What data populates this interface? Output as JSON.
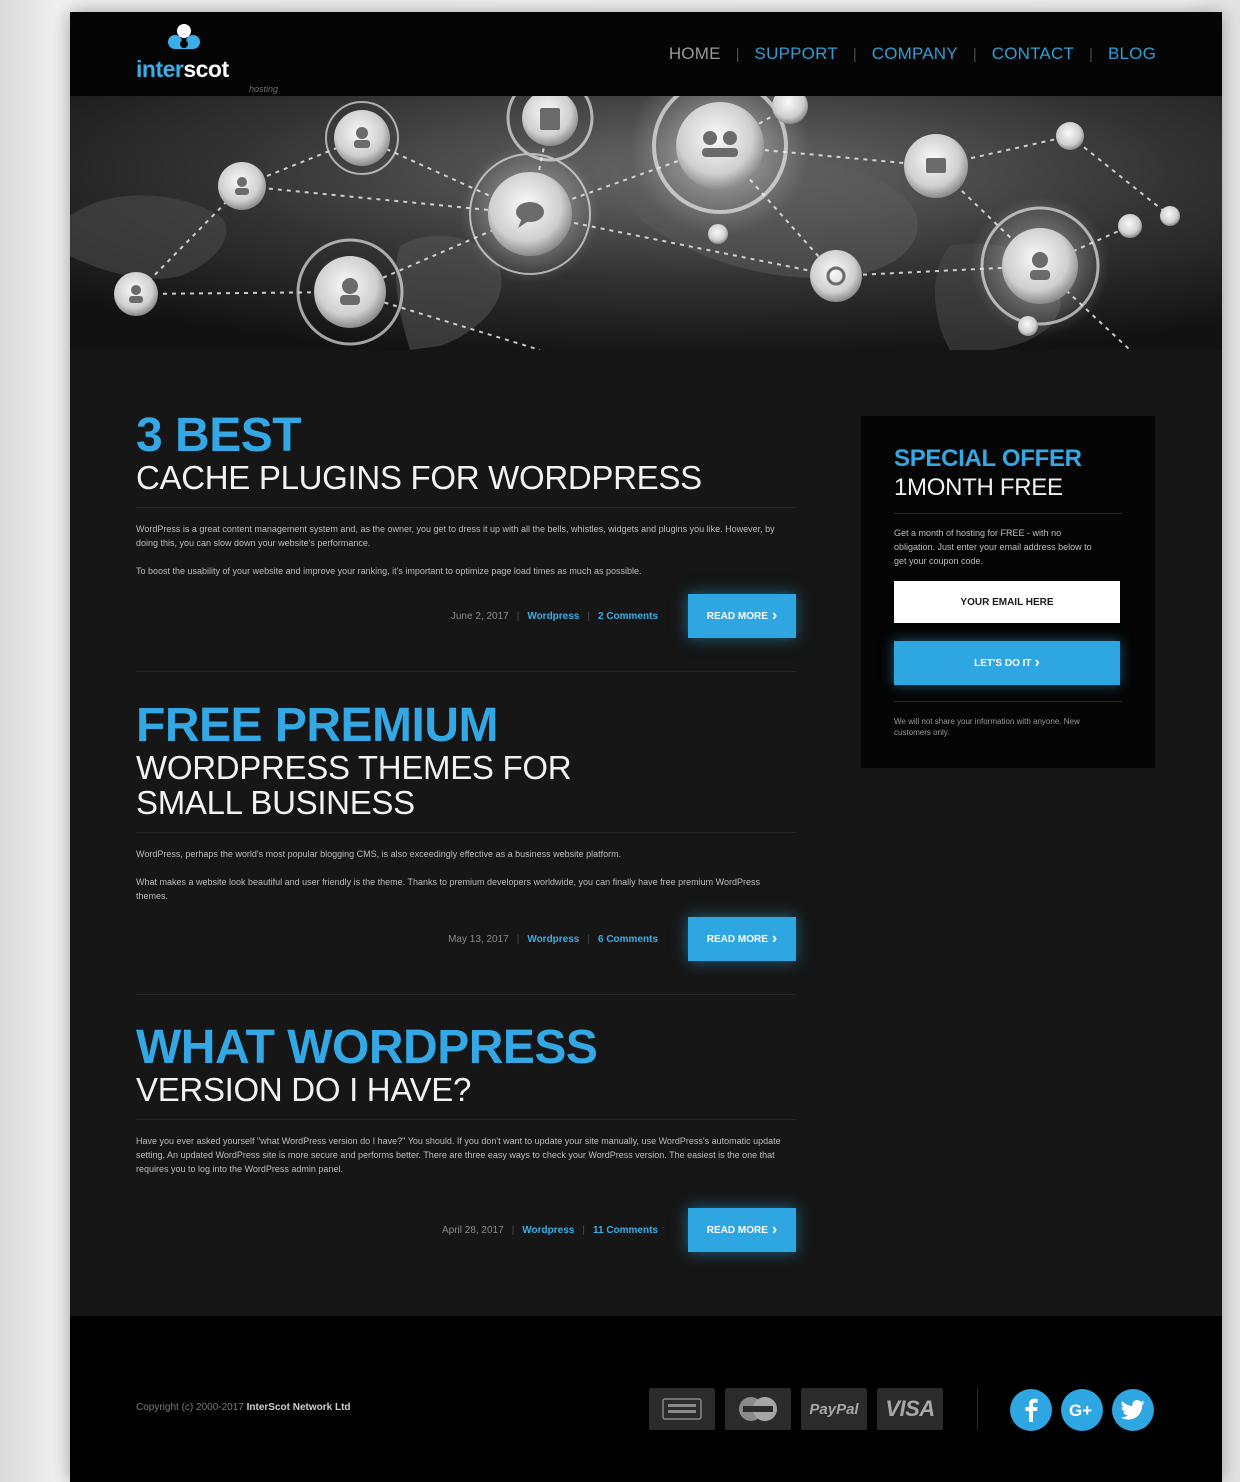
{
  "brand": {
    "name_part1": "inter",
    "name_part2": "scot",
    "tagline": "hosting"
  },
  "nav": [
    {
      "label": "HOME"
    },
    {
      "label": "SUPPORT"
    },
    {
      "label": "COMPANY"
    },
    {
      "label": "CONTACT"
    },
    {
      "label": "BLOG"
    }
  ],
  "posts": [
    {
      "title_highlight": "3 BEST",
      "title_rest": [
        "CACHE PLUGINS FOR WORDPRESS"
      ],
      "paragraphs": [
        "WordPress is a great content management system and, as the owner, you get to dress it up with all the bells, whistles, widgets and plugins you like. However, by doing this, you can slow down your website's performance.",
        "To boost the usability of your website and improve your ranking, it's important to optimize page load times as much as possible."
      ],
      "date": "June 2, 2017",
      "category": "Wordpress",
      "comments": "2 Comments",
      "button": "READ MORE"
    },
    {
      "title_highlight": "FREE PREMIUM",
      "title_rest": [
        "WORDPRESS THEMES FOR",
        "SMALL BUSINESS"
      ],
      "paragraphs": [
        "WordPress, perhaps the world's most popular blogging CMS, is also exceedingly effective as a business website platform.",
        "What makes a website look beautiful and user friendly is the theme. Thanks to premium developers worldwide, you can finally have free premium WordPress themes."
      ],
      "date": "May 13, 2017",
      "category": "Wordpress",
      "comments": "6 Comments",
      "button": "READ MORE"
    },
    {
      "title_highlight": "WHAT WORDPRESS",
      "title_rest": [
        "VERSION DO I HAVE?"
      ],
      "paragraphs": [
        "Have you ever asked yourself \"what WordPress version do I have?\" You should. If you don't want to update your site manually, use WordPress's automatic update setting. An updated WordPress site is more secure and performs better. There are three easy ways to check your WordPress version. The easiest is the one that requires you to log into the WordPress admin panel."
      ],
      "date": "April 28, 2017",
      "category": "Wordpress",
      "comments": "11 Comments",
      "button": "READ MORE"
    }
  ],
  "offer": {
    "title": "SPECIAL OFFER",
    "subtitle": "1MONTH FREE",
    "text": "Get a month of hosting for FREE - with no obligation. Just enter your email address below to get your coupon code.",
    "email_placeholder": "YOUR EMAIL HERE",
    "button": "LET'S DO IT",
    "note": "We will not share your information with anyone. New customers only."
  },
  "footer": {
    "copyright_prefix": "Copyright (c) 2000-2017",
    "copyright_company": "InterScot Network Ltd",
    "payments": [
      "American Express",
      "MasterCard",
      "PayPal",
      "VISA"
    ],
    "social": [
      "facebook",
      "google-plus",
      "twitter"
    ]
  },
  "colors": {
    "accent": "#2ea6e2",
    "background": "#161616",
    "header": "#050505",
    "footer": "#000000"
  },
  "icons": [
    "logo-cloud-icon",
    "chevron-right-icon",
    "facebook-icon",
    "google-plus-icon",
    "twitter-icon"
  ]
}
